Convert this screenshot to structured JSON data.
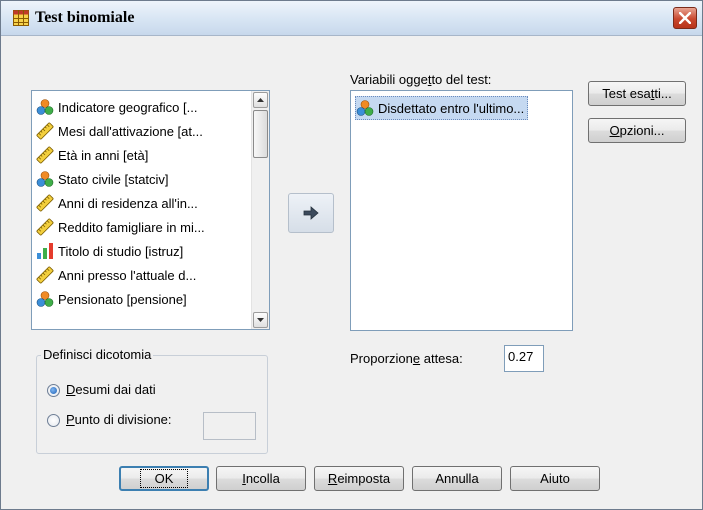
{
  "window": {
    "title": "Test binomiale"
  },
  "source_list": {
    "items": [
      {
        "label": "Indicatore geografico [...",
        "icon": "nominal-icon"
      },
      {
        "label": "Mesi dall'attivazione [at...",
        "icon": "scale-icon"
      },
      {
        "label": "Età in anni [età]",
        "icon": "scale-icon"
      },
      {
        "label": "Stato civile [statciv]",
        "icon": "nominal-icon"
      },
      {
        "label": "Anni di residenza all'in...",
        "icon": "scale-icon"
      },
      {
        "label": "Reddito famigliare in mi...",
        "icon": "scale-icon"
      },
      {
        "label": "Titolo di studio [istruz]",
        "icon": "ordinal-icon"
      },
      {
        "label": "Anni presso l'attuale d...",
        "icon": "scale-icon"
      },
      {
        "label": "Pensionato [pensione]",
        "icon": "nominal-icon"
      }
    ]
  },
  "target": {
    "label_pre": "Variabili ogge",
    "label_u": "t",
    "label_post": "to del test:",
    "items": [
      {
        "label": "Disdettato entro l'ultimo...",
        "icon": "nominal-icon"
      }
    ]
  },
  "buttons": {
    "exact_pre": "Test esa",
    "exact_u": "t",
    "exact_post": "ti...",
    "options_u": "O",
    "options_post": "pzioni...",
    "ok": "OK",
    "paste_u": "I",
    "paste_post": "ncolla",
    "reset_u": "R",
    "reset_post": "eimposta",
    "cancel": "Annulla",
    "help": "Aiuto"
  },
  "dichotomy": {
    "legend": "Definisci dicotomia",
    "from_data_u": "D",
    "from_data_post": "esumi dai dati",
    "cut_u": "P",
    "cut_post": "unto di divisione:",
    "cut_value": "",
    "selected": "from_data"
  },
  "proportion": {
    "label_pre": "Proporzion",
    "label_u": "e",
    "label_post": " attesa:",
    "value": "0.27"
  },
  "colors": {
    "title_bg": "#d9e6f4",
    "close": "#c9472e",
    "selection": "#c5d9f1",
    "dialog_bg": "#f0f0f0"
  }
}
